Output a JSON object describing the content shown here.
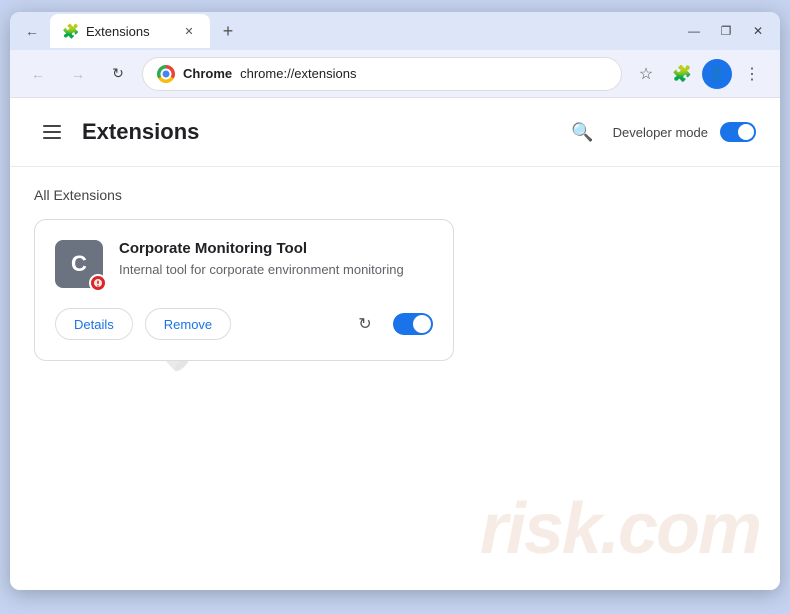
{
  "browser": {
    "tab_label": "Extensions",
    "url": "chrome://extensions",
    "chrome_brand": "Chrome",
    "new_tab_symbol": "+",
    "window_controls": {
      "minimize": "—",
      "maximize": "❐",
      "close": "✕"
    }
  },
  "extensions_page": {
    "menu_icon": "☰",
    "title": "Extensions",
    "search_icon": "🔍",
    "developer_mode_label": "Developer mode",
    "section_title": "All Extensions",
    "extension": {
      "icon_letter": "C",
      "name": "Corporate Monitoring Tool",
      "description": "Internal tool for corporate environment monitoring",
      "details_button": "Details",
      "remove_button": "Remove"
    }
  },
  "watermark": {
    "line1": "risk.com"
  }
}
